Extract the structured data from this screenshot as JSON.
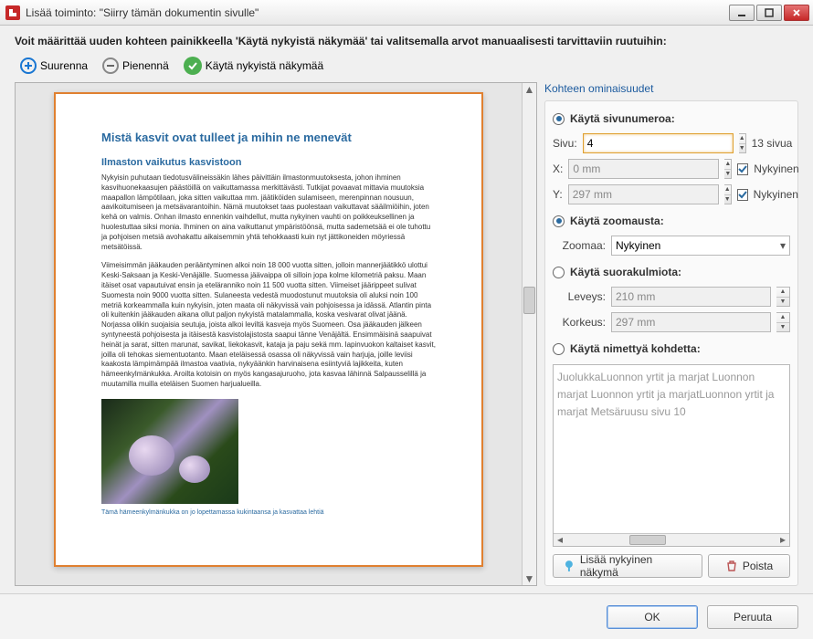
{
  "window": {
    "title": "Lisää toiminto: \"Siirry tämän dokumentin sivulle\""
  },
  "instruction": "Voit määrittää uuden kohteen painikkeella 'Käytä nykyistä näkymää' tai valitsemalla arvot manuaalisesti tarvittaviin ruutuihin:",
  "toolbar": {
    "zoom_in": "Suurenna",
    "zoom_out": "Pienennä",
    "use_current": "Käytä nykyistä näkymää"
  },
  "preview": {
    "heading": "Mistä kasvit ovat tulleet ja mihin ne menevät",
    "subheading": "Ilmaston vaikutus kasvistoon",
    "para1": "Nykyisin puhutaan tiedotusvälineissäkin lähes päivittäin ilmastonmuutoksesta, johon ihminen kasvihuonekaasujen päästöillä on vaikuttamassa merkittävästi. Tutkijat povaavat mittavia muutoksia maapallon lämpötilaan, joka sitten vaikuttaa mm. jäätiköiden sulamiseen, merenpinnan nousuun, aavikoitumiseen ja metsävarantoihin. Nämä muutokset taas puolestaan vaikuttavat sääilmiöihin, joten kehä on valmis. Onhan ilmasto ennenkin vaihdellut, mutta nykyinen vauhti on poikkeuksellinen ja huolestuttaa siksi monia. Ihminen on aina vaikuttanut ympäristöönsä, mutta sademetsää ei ole tuhottu ja pohjoisen metsiä avohakattu aikaisemmin yhtä tehokkaasti kuin nyt jättikoneiden möyriessä metsätöissä.",
    "para2": "Viimeisimmän jääkauden perääntyminen alkoi noin 18 000 vuotta sitten, jolloin mannerjäätikkö ulottui Keski-Saksaan ja Keski-Venäjälle. Suomessa jäävaippa oli silloin jopa kolme kilometriä paksu. Maan itäiset osat vapautuivat ensin ja eteläranniko noin 11 500 vuotta sitten. Viimeiset jäärippeet sulivat Suomesta noin 9000 vuotta sitten. Sulaneesta vedestä muodostunut muutoksia oli aluksi noin 100 metriä korkeammalla kuin nykyisin, joten maata oli näkyvissä vain pohjoisessa ja idässä. Atlantin pinta oli kuitenkin jääkauden aikana ollut paljon nykyistä matalammalla, koska vesivarat olivat jäänä. Norjassa olikin suojaisia seutuja, joista alkoi leviltä kasveja myös Suomeen. Osa jääkauden jälkeen syntyneestä pohjoisesta ja itäisestä kasvistolajistosta saapui tänne Venäjältä. Ensimmäisinä saapuivat heinät ja sarat, sitten marunat, savikat, liekokasvit, kataja ja paju sekä mm. lapinvuokon kaltaiset kasvit, joilla oli tehokas siementuotanto. Maan eteläisessä osassa oli näkyvissä vain harjuja, joille leviisi kaakosta lämpimämpää ilmastoa vaativia, nykyäänkin harvinaisena esiintyviä lajikkeita, kuten hämeenkylmänkukka. Aroilta kotoisin on myös kangasajuruoho, jota kasvaa lähinnä Salpausselillä ja muutamilla muilla eteläisen Suomen harjualueilla.",
    "caption": "Tämä hämeenkylmänkukka on jo lopettamassa kukintaansa ja kasvattaa lehtiä"
  },
  "side": {
    "title": "Kohteen ominaisuudet",
    "opt_page": "Käytä sivunumeroa:",
    "opt_zoom": "Käytä zoomausta:",
    "opt_rect": "Käytä suorakulmiota:",
    "opt_named": "Käytä nimettyä kohdetta:",
    "lbl_page": "Sivu:",
    "lbl_x": "X:",
    "lbl_y": "Y:",
    "lbl_zoom": "Zoomaa:",
    "lbl_width": "Leveys:",
    "lbl_height": "Korkeus:",
    "val_page": "4",
    "page_total": "13 sivua",
    "val_x": "0 mm",
    "val_y": "297 mm",
    "current": "Nykyinen",
    "val_zoom": "Nykyinen",
    "val_width": "210 mm",
    "val_height": "297 mm",
    "targets_text": "JuolukkaLuonnon yrtit ja marjat Luonnon marjat Luonnon yrtit ja marjatLuonnon yrtit ja marjat Metsäruusu sivu 10",
    "btn_add": "Lisää nykyinen näkymä",
    "btn_del": "Poista"
  },
  "footer": {
    "ok": "OK",
    "cancel": "Peruuta"
  }
}
